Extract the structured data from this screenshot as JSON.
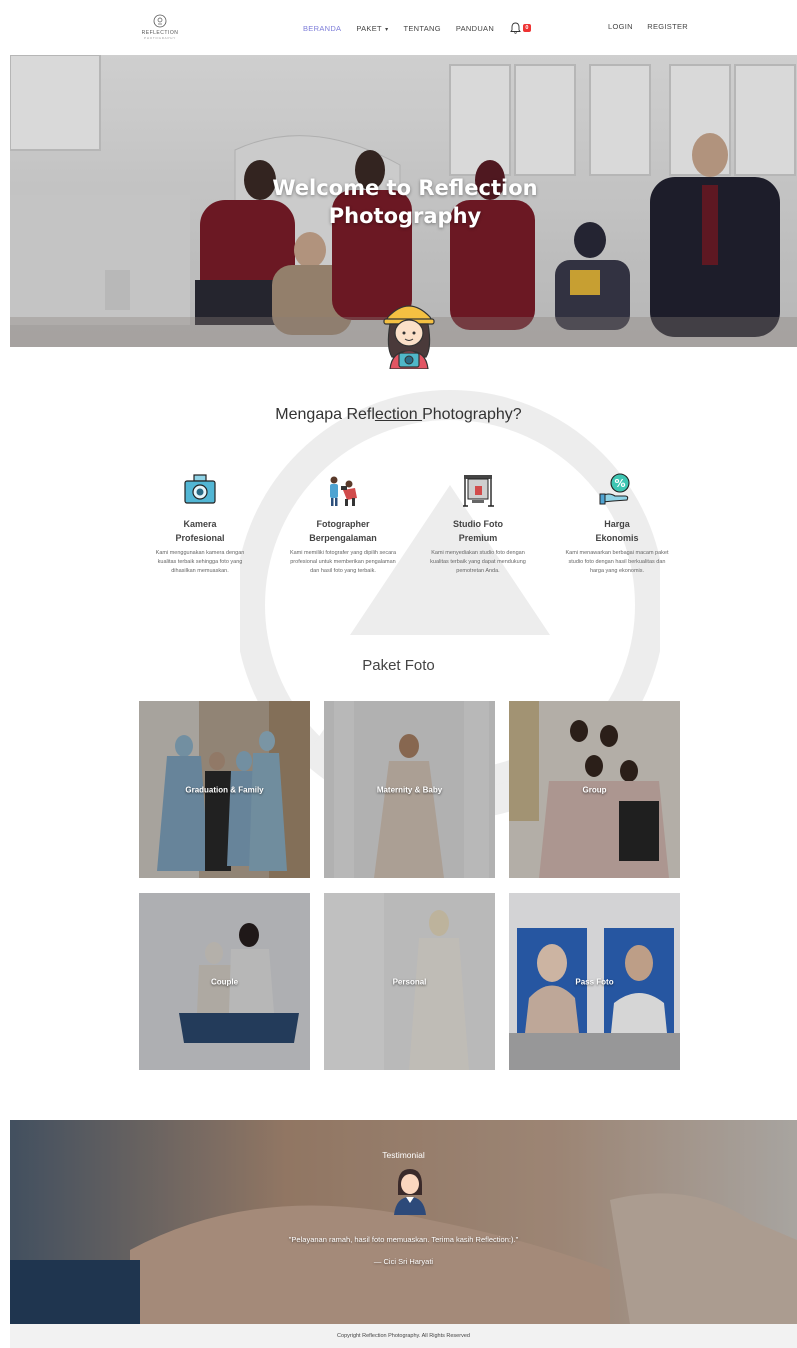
{
  "brand": {
    "name": "REFLECTION",
    "tagline": "PHOTOGRAPHY"
  },
  "nav": {
    "items": [
      {
        "label": "BERANDA",
        "active": true
      },
      {
        "label": "PAKET",
        "dropdown": true
      },
      {
        "label": "TENTANG"
      },
      {
        "label": "PANDUAN"
      }
    ],
    "notification_count": "0",
    "login": "LOGIN",
    "register": "REGISTER"
  },
  "hero": {
    "title_line1": "Welcome to Reflection",
    "title_line2": "Photography"
  },
  "why": {
    "title_pre": "Mengapa Refl",
    "title_under": "ection ",
    "title_post": "Photography?",
    "features": [
      {
        "icon": "camera-icon",
        "title1": "Kamera",
        "title2": "Profesional",
        "desc": "Kami menggunakan kamera dengan kualitas terbaik sehingga foto yang dihasilkan memuaskan."
      },
      {
        "icon": "photographer-icon",
        "title1": "Fotographer",
        "title2": "Berpengalaman",
        "desc": "Kami memiliki fotografer yang dipilih secara profesional untuk memberikan pengalaman dan hasil foto yang terbaik."
      },
      {
        "icon": "studio-icon",
        "title1": "Studio Foto",
        "title2": "Premium",
        "desc": "Kami menyediakan studio foto dengan kualitas terbaik yang dapat mendukung pemotretan Anda."
      },
      {
        "icon": "discount-icon",
        "title1": "Harga",
        "title2": "Ekonomis",
        "desc": "Kami menawarkan berbagai macam paket studio foto dengan hasil berkualitas dan harga yang ekonomis."
      }
    ]
  },
  "paket": {
    "title": "Paket Foto",
    "cards": [
      {
        "label": "Graduation & Family"
      },
      {
        "label": "Maternity & Baby"
      },
      {
        "label": "Group"
      },
      {
        "label": "Couple"
      },
      {
        "label": "Personal"
      },
      {
        "label": "Pass Foto"
      }
    ]
  },
  "testimonial": {
    "title": "Testimonial",
    "quote": "\"Pelayanan ramah, hasil foto memuaskan. Terima kasih Reflection:).\"",
    "author": "— Cici Sri Haryati"
  },
  "footer": {
    "copyright": "Copyright Reflection Photography. All Rights Reserved"
  },
  "colors": {
    "nav_active": "#7e7ed9",
    "badge": "#e33333",
    "footer_bg": "#f2f2f2"
  }
}
